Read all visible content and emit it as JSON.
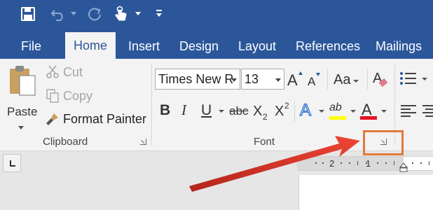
{
  "quick_access": {
    "icons": [
      "save-icon",
      "undo-icon",
      "redo-icon",
      "touch-mode-icon",
      "customize-qat-icon"
    ]
  },
  "tabs": [
    {
      "label": "File",
      "active": false
    },
    {
      "label": "Home",
      "active": true
    },
    {
      "label": "Insert",
      "active": false
    },
    {
      "label": "Design",
      "active": false
    },
    {
      "label": "Layout",
      "active": false
    },
    {
      "label": "References",
      "active": false
    },
    {
      "label": "Mailings",
      "active": false
    }
  ],
  "clipboard": {
    "group_label": "Clipboard",
    "paste_label": "Paste",
    "cut_label": "Cut",
    "copy_label": "Copy",
    "format_painter_label": "Format Painter"
  },
  "font": {
    "group_label": "Font",
    "font_name": "Times New R",
    "font_size": "13",
    "grow_label": "A",
    "shrink_label": "A",
    "change_case_label": "Aa",
    "bold_label": "B",
    "italic_label": "I",
    "underline_label": "U",
    "strikethrough_label": "abc",
    "subscript_label": "X",
    "subscript_sub": "2",
    "superscript_label": "X",
    "superscript_sup": "2",
    "text_effects_label": "A",
    "highlight_label": "ab",
    "font_color_label": "A"
  },
  "ruler": {
    "numbers": [
      "2",
      "1"
    ]
  },
  "colors": {
    "title_bar": "#2b579a",
    "ribbon": "#f3f3f3",
    "highlight_color": "#ffff00",
    "font_color": "#e81123",
    "annotation": "#e07a3c",
    "arrow": "#e8392b"
  }
}
